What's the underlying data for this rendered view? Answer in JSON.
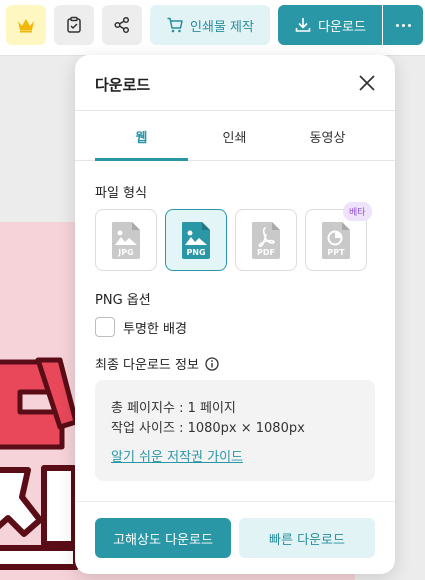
{
  "toolbar": {
    "print_label": "인쇄물 제작",
    "download_label": "다운로드"
  },
  "panel": {
    "title": "다운로드",
    "tabs": [
      {
        "label": "웹",
        "active": true
      },
      {
        "label": "인쇄",
        "active": false
      },
      {
        "label": "동영상",
        "active": false
      }
    ],
    "file_format": {
      "label": "파일 형식",
      "options": [
        {
          "label": "JPG",
          "selected": false
        },
        {
          "label": "PNG",
          "selected": true
        },
        {
          "label": "PDF",
          "selected": false
        },
        {
          "label": "PPT",
          "selected": false,
          "badge": "베타"
        }
      ]
    },
    "png_options": {
      "label": "PNG 옵션",
      "transparent_bg": {
        "label": "투명한 배경",
        "checked": false
      }
    },
    "final_info": {
      "label": "최종 다운로드 정보",
      "total_pages": "총 페이지수 : 1 페이지",
      "work_size": "작업 사이즈 : 1080px × 1080px",
      "guide_link": "알기 쉬운 저작권 가이드"
    },
    "buttons": {
      "high_res": "고해상도 다운로드",
      "fast": "빠른 다운로드"
    }
  },
  "colors": {
    "accent": "#2a97a6",
    "accent_light": "#e1f3f5",
    "beta": "#9155d6"
  }
}
